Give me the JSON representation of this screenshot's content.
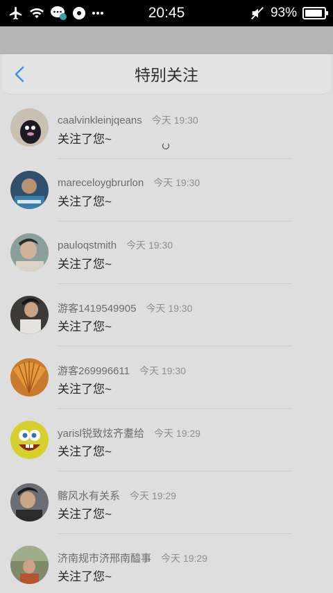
{
  "status_bar": {
    "time": "20:45",
    "battery": "93%",
    "battery_level": 0.93
  },
  "header": {
    "title": "特别关注",
    "back_icon": "chevron-left-icon"
  },
  "accent_color": "#4a90d9",
  "items": [
    {
      "name": "caalvinkleinjqeans",
      "time": "今天 19:30",
      "message": "关注了您~"
    },
    {
      "name": "mareceloygbrurlon",
      "time": "今天 19:30",
      "message": "关注了您~"
    },
    {
      "name": "pauloqstmith",
      "time": "今天 19:30",
      "message": "关注了您~"
    },
    {
      "name": "游客1419549905",
      "time": "今天 19:30",
      "message": "关注了您~"
    },
    {
      "name": "游客269996611",
      "time": "今天 19:30",
      "message": "关注了您~"
    },
    {
      "name": "yarisl锐致炫齐耋给",
      "time": "今天 19:29",
      "message": "关注了您~"
    },
    {
      "name": "髂风水有关系",
      "time": "今天 19:29",
      "message": "关注了您~"
    },
    {
      "name": "济南规市济邢南醯事",
      "time": "今天 19:29",
      "message": "关注了您~"
    }
  ]
}
